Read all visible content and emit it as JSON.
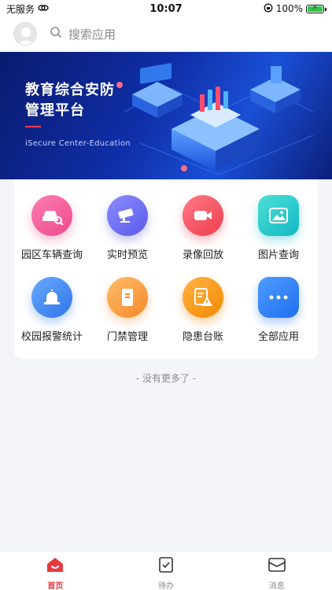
{
  "status_bar": {
    "carrier": "无服务",
    "time": "10:07",
    "battery": "100%"
  },
  "header": {
    "search_placeholder": "搜索应用"
  },
  "banner": {
    "title": "教育综合安防管理平台",
    "subtitle": "iSecure Center-Education"
  },
  "apps": [
    {
      "label": "园区车辆查询",
      "icon": "car-search-icon",
      "color": "#f0579a"
    },
    {
      "label": "实时预览",
      "icon": "camera-icon",
      "color": "#6c6cf2"
    },
    {
      "label": "录像回放",
      "icon": "video-icon",
      "color": "#f25561"
    },
    {
      "label": "图片查询",
      "icon": "image-icon",
      "color": "#25c9c9"
    },
    {
      "label": "校园报警统计",
      "icon": "alarm-icon",
      "color": "#3a86f0"
    },
    {
      "label": "门禁管理",
      "icon": "door-icon",
      "color": "#f59a3e"
    },
    {
      "label": "隐患台账",
      "icon": "hazard-ledger-icon",
      "color": "#f5931e"
    },
    {
      "label": "全部应用",
      "icon": "more-icon",
      "color": "#2f86f6"
    }
  ],
  "footer_note": "- 没有更多了 -",
  "tabs": [
    {
      "label": "首页",
      "icon": "home-icon",
      "active": true
    },
    {
      "label": "待办",
      "icon": "todo-icon",
      "active": false
    },
    {
      "label": "消息",
      "icon": "message-icon",
      "active": false
    }
  ],
  "colors": {
    "accent": "#e8383d",
    "banner": "#0f2fa8",
    "background": "#f4f5f8"
  }
}
